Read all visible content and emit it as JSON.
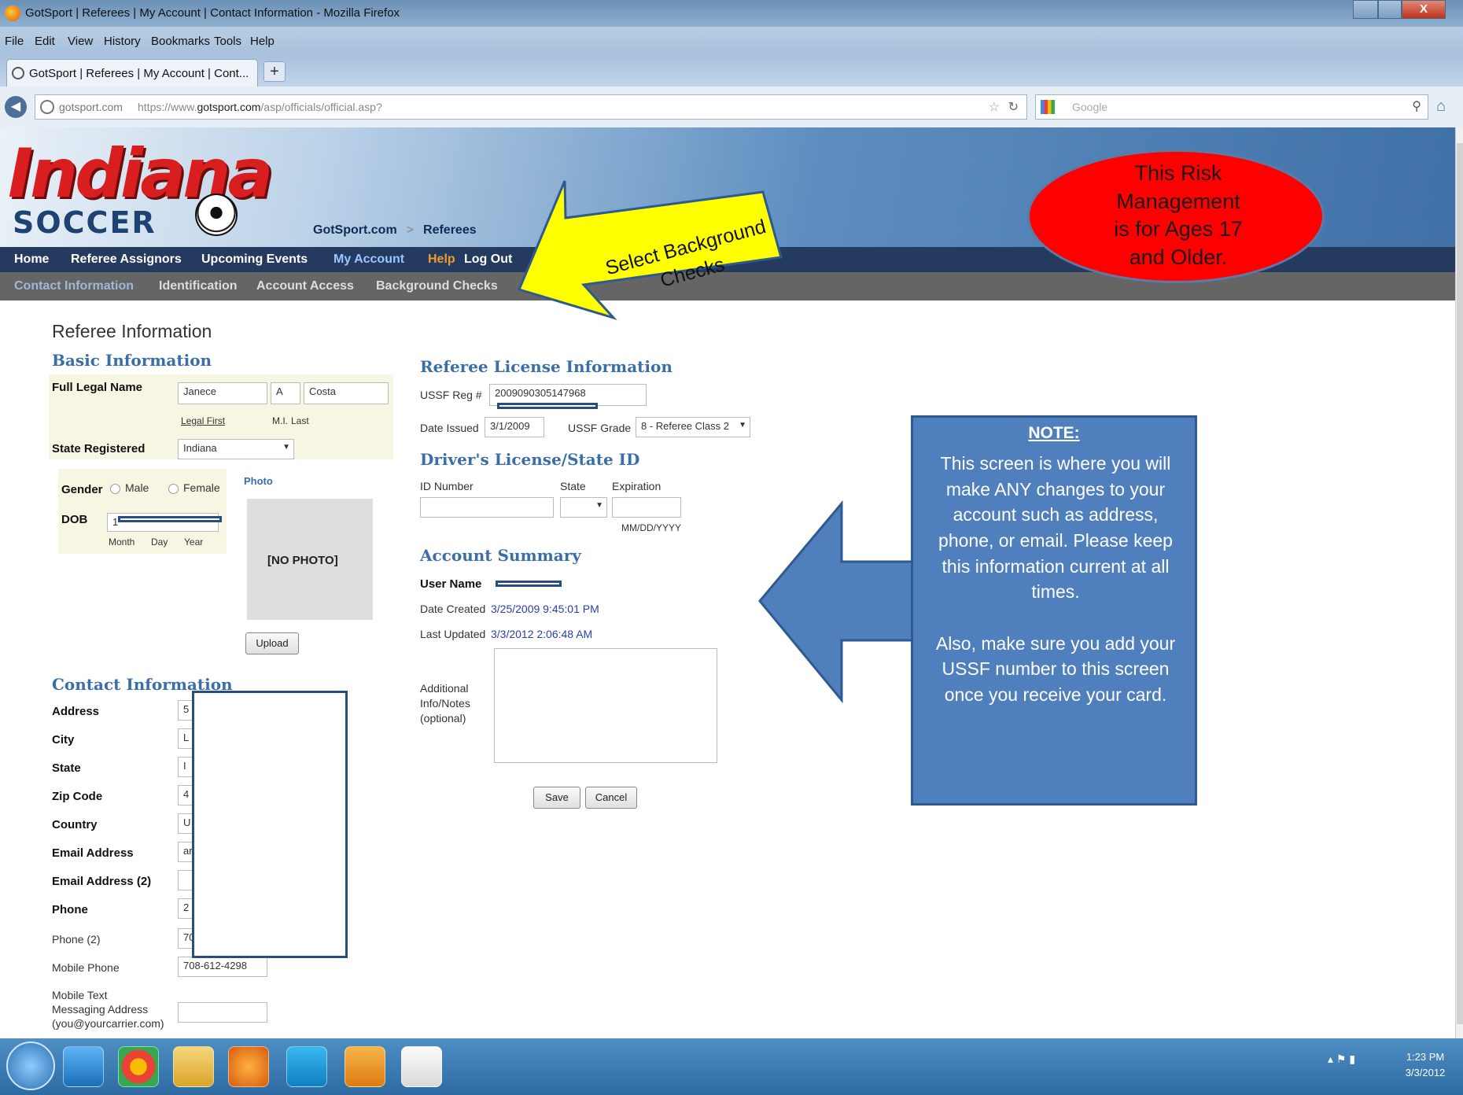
{
  "browser": {
    "title": "GotSport | Referees | My Account | Contact Information - Mozilla Firefox",
    "menu": [
      "File",
      "Edit",
      "View",
      "History",
      "Bookmarks",
      "Tools",
      "Help"
    ],
    "tab_label": "GotSport | Referees | My Account | Cont...",
    "url_site": "gotsport.com",
    "url_prefix": "https://www.",
    "url_domain": "gotsport.com",
    "url_path": "/asp/officials/official.asp?",
    "search_placeholder": "Google"
  },
  "site": {
    "logo_top": "Indiana",
    "logo_bottom": "SOCCER",
    "breadcrumb": [
      "GotSport.com",
      ">",
      "Referees"
    ],
    "nav": [
      "Home",
      "Referee Assignors",
      "Upcoming Events",
      "My Account",
      "Help",
      "Log Out"
    ],
    "subnav": [
      "Contact Information",
      "Identification",
      "Account Access",
      "Background Checks"
    ]
  },
  "page": {
    "title": "Referee Information",
    "basic": {
      "heading": "Basic Information",
      "full_name_label": "Full Legal Name",
      "first": "Janece",
      "mi": "A",
      "last": "Costa",
      "first_caption": "Legal First",
      "mi_caption": "M.I.",
      "last_caption": "Last",
      "state_label": "State Registered",
      "state_value": "Indiana",
      "gender_label": "Gender",
      "male": "Male",
      "female": "Female",
      "dob_label": "DOB",
      "dob_partial": "1",
      "month": "Month",
      "day": "Day",
      "year": "Year",
      "photo_label": "Photo",
      "no_photo": "[NO PHOTO]",
      "upload": "Upload"
    },
    "license": {
      "heading": "Referee License Information",
      "ussf_label": "USSF Reg #",
      "ussf_value": "2009090305147968",
      "date_issued_label": "Date Issued",
      "date_issued": "3/1/2009",
      "grade_label": "USSF Grade",
      "grade_value": "8 - Referee Class 2"
    },
    "driver": {
      "heading": "Driver's License/State ID",
      "id_label": "ID Number",
      "state_label": "State",
      "exp_label": "Expiration",
      "exp_hint": "MM/DD/YYYY"
    },
    "summary": {
      "heading": "Account Summary",
      "user_label": "User Name",
      "created_label": "Date Created",
      "created": "3/25/2009 9:45:01 PM",
      "updated_label": "Last Updated",
      "updated": "3/3/2012 2:06:48 AM",
      "notes_label": "Additional\nInfo/Notes\n(optional)"
    },
    "save": "Save",
    "cancel": "Cancel",
    "contact": {
      "heading": "Contact Information",
      "labels": [
        "Address",
        "City",
        "State",
        "Zip Code",
        "Country",
        "Email Address",
        "Email Address (2)",
        "Phone"
      ],
      "partials": [
        "5",
        "L",
        "I",
        "4",
        "U",
        "ar",
        "",
        "2"
      ],
      "phone2_label": "Phone (2)",
      "phone2_partial": "70",
      "mobile_label": "Mobile Phone",
      "mobile_value": "708-612-4298",
      "text_label": "Mobile Text\nMessaging Address\n(you@yourcarrier.com)"
    }
  },
  "annotations": {
    "yellow_arrow": "Select Background\nChecks",
    "red_oval": "This Risk\nManagement\nis for Ages 17\nand Older.",
    "note_title": "NOTE:",
    "note_body": "This screen is where you will make ANY changes to your account such as address, phone, or email.  Please keep this information current at all times.\n\nAlso, make sure you add your USSF number to this screen once you receive your card."
  },
  "taskbar": {
    "time": "1:23 PM",
    "date": "3/3/2012"
  },
  "colors": {
    "site_nav": "#243a5e",
    "subnav": "#656565",
    "section_heading": "#3a6ea8",
    "note_box": "#4f7fbd",
    "oval": "#ff0000",
    "arrow": "#ffff00"
  }
}
